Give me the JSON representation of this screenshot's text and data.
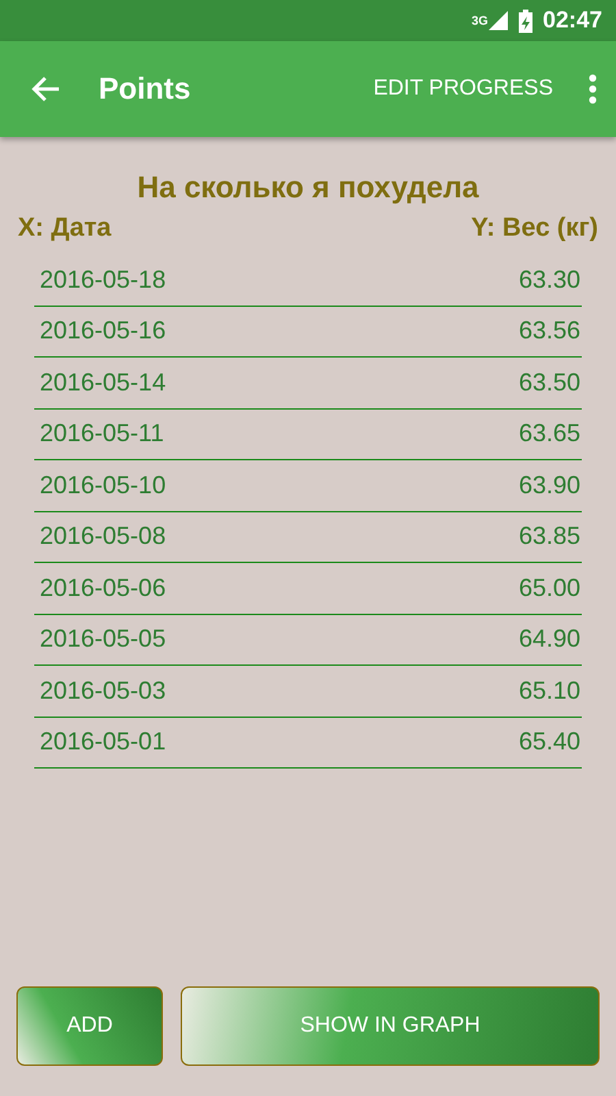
{
  "status_bar": {
    "network": "3G",
    "time": "02:47"
  },
  "toolbar": {
    "title": "Points",
    "action": "EDIT PROGRESS"
  },
  "heading": "На сколько я похудела",
  "x_label": "X: Дата",
  "y_label": "Y: Вес (кг)",
  "points": [
    {
      "date": "2016-05-18",
      "value": "63.30"
    },
    {
      "date": "2016-05-16",
      "value": "63.56"
    },
    {
      "date": "2016-05-14",
      "value": "63.50"
    },
    {
      "date": "2016-05-11",
      "value": "63.65"
    },
    {
      "date": "2016-05-10",
      "value": "63.90"
    },
    {
      "date": "2016-05-08",
      "value": "63.85"
    },
    {
      "date": "2016-05-06",
      "value": "65.00"
    },
    {
      "date": "2016-05-05",
      "value": "64.90"
    },
    {
      "date": "2016-05-03",
      "value": "65.10"
    },
    {
      "date": "2016-05-01",
      "value": "65.40"
    }
  ],
  "buttons": [
    "ADD",
    "SHOW IN GRAPH"
  ]
}
